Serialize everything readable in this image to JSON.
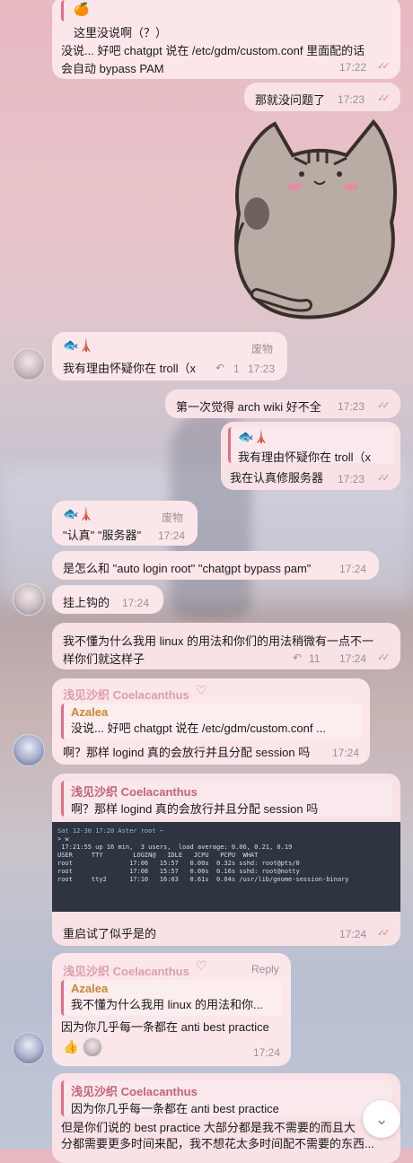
{
  "messages": {
    "m1": {
      "line1": "这里没说啊（？）",
      "line2": "没说... 好吧 chatgpt 说在 /etc/gdm/custom.conf 里面配的话",
      "line3": "会自动 bypass PAM",
      "time": "17:22"
    },
    "m2": {
      "text": "那就没问题了",
      "time": "17:23"
    },
    "m3": {
      "tag": "废物",
      "text": "我有理由怀疑你在 troll（x",
      "reply_count": "1",
      "time": "17:23"
    },
    "m4": {
      "text": "第一次觉得 arch wiki 好不全",
      "time": "17:23"
    },
    "m5": {
      "quote": "我有理由怀疑你在 troll（x",
      "text": "我在认真修服务器",
      "time": "17:23"
    },
    "m6": {
      "tag": "废物",
      "text": "\"认真\" \"服务器\"",
      "time": "17:24"
    },
    "m7": {
      "text": "是怎么和 \"auto login root\" \"chatgpt bypass pam\"",
      "time": "17:24"
    },
    "m8": {
      "text": "挂上钩的",
      "time": "17:24"
    },
    "m9": {
      "line1": "我不懂为什么我用 linux 的用法和你们的用法稍微有一点不一",
      "line2": "样你们就这样子",
      "reply_count": "11",
      "time": "17:24"
    },
    "m10": {
      "name": "浅见沙织 Coelacanthus",
      "quote_name": "Azalea",
      "quote_text": "没说... 好吧 chatgpt 说在 /etc/gdm/custom.conf ...",
      "text": "啊？那样 logind 真的会放行并且分配 session 吗",
      "time": "17:24"
    },
    "m11": {
      "quote_name": "浅见沙织 Coelacanthus",
      "quote_text": "啊？那样 logind 真的会放行并且分配 session 吗",
      "caption": "重启试了似乎是的",
      "time": "17:24"
    },
    "m12": {
      "name": "浅见沙织 Coelacanthus",
      "tag": "Reply",
      "quote_name": "Azalea",
      "quote_text": "我不懂为什么我用 linux 的用法和你...",
      "text": "因为你几乎每一条都在 anti best practice",
      "time": "17:24"
    },
    "m13": {
      "quote_name": "浅见沙织 Coelacanthus",
      "quote_text": "因为你几乎每一条都在 anti best practice",
      "line1": "但是你们说的 best practice 大部分都是我不需要的而且大",
      "line2": "分都需要更多时间来配，我不想花太多时间配不需要的东西..."
    }
  },
  "terminal": {
    "prompt": "Sat 12-30 17:20 Aster root ~",
    "cmd": "> w",
    "lines": [
      " 17:21:55 up 16 min,  3 users,  load average: 0.06, 0.21, 0.19",
      "USER     TTY        LOGIN@   IDLE   JCPU   PCPU  WHAT",
      "root               17:06   15:57   0.00s  0.32s sshd: root@pts/0",
      "root               17:08   15:57   0.00s  0.16s sshd: root@notty",
      "root     tty2      17:10   16:03   0.61s  0.04s /usr/lib/gnome-session-binary"
    ]
  },
  "icons": {
    "scroll_down": "chevron-down-icon",
    "reply": "reply-arrow-icon",
    "read": "double-check-icon"
  },
  "colors": {
    "accent": "#c8607a",
    "bubble": "#fbe7ea",
    "check": "#d48a97"
  }
}
